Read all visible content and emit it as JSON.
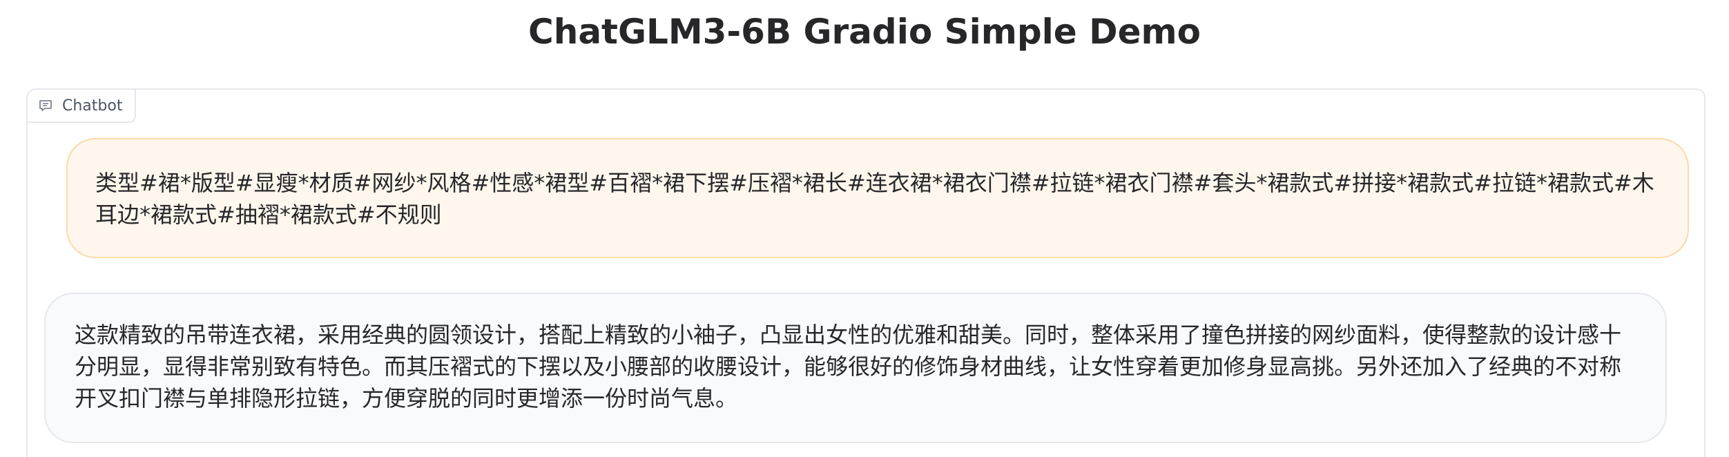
{
  "app": {
    "title": "ChatGLM3-6B Gradio Simple Demo"
  },
  "chatbot": {
    "label": "Chatbot",
    "label_icon": "chat-icon",
    "messages": [
      {
        "role": "user",
        "text": "类型#裙*版型#显瘦*材质#网纱*风格#性感*裙型#百褶*裙下摆#压褶*裙长#连衣裙*裙衣门襟#拉链*裙衣门襟#套头*裙款式#拼接*裙款式#拉链*裙款式#木耳边*裙款式#抽褶*裙款式#不规则"
      },
      {
        "role": "assistant",
        "text": "这款精致的吊带连衣裙，采用经典的圆领设计，搭配上精致的小袖子，凸显出女性的优雅和甜美。同时，整体采用了撞色拼接的网纱面料，使得整款的设计感十分明显，显得非常别致有特色。而其压褶式的下摆以及小腰部的收腰设计，能够很好的修饰身材曲线，让女性穿着更加修身显高挑。另外还加入了经典的不对称开叉扣门襟与单排隐形拉链，方便穿脱的同时更增添一份时尚气息。"
      }
    ]
  },
  "colors": {
    "user_bubble_bg": "#fff7ed",
    "user_bubble_border": "#fcd9a8",
    "bot_bubble_bg": "#f9fafb",
    "bot_bubble_border": "#e5e7eb"
  }
}
